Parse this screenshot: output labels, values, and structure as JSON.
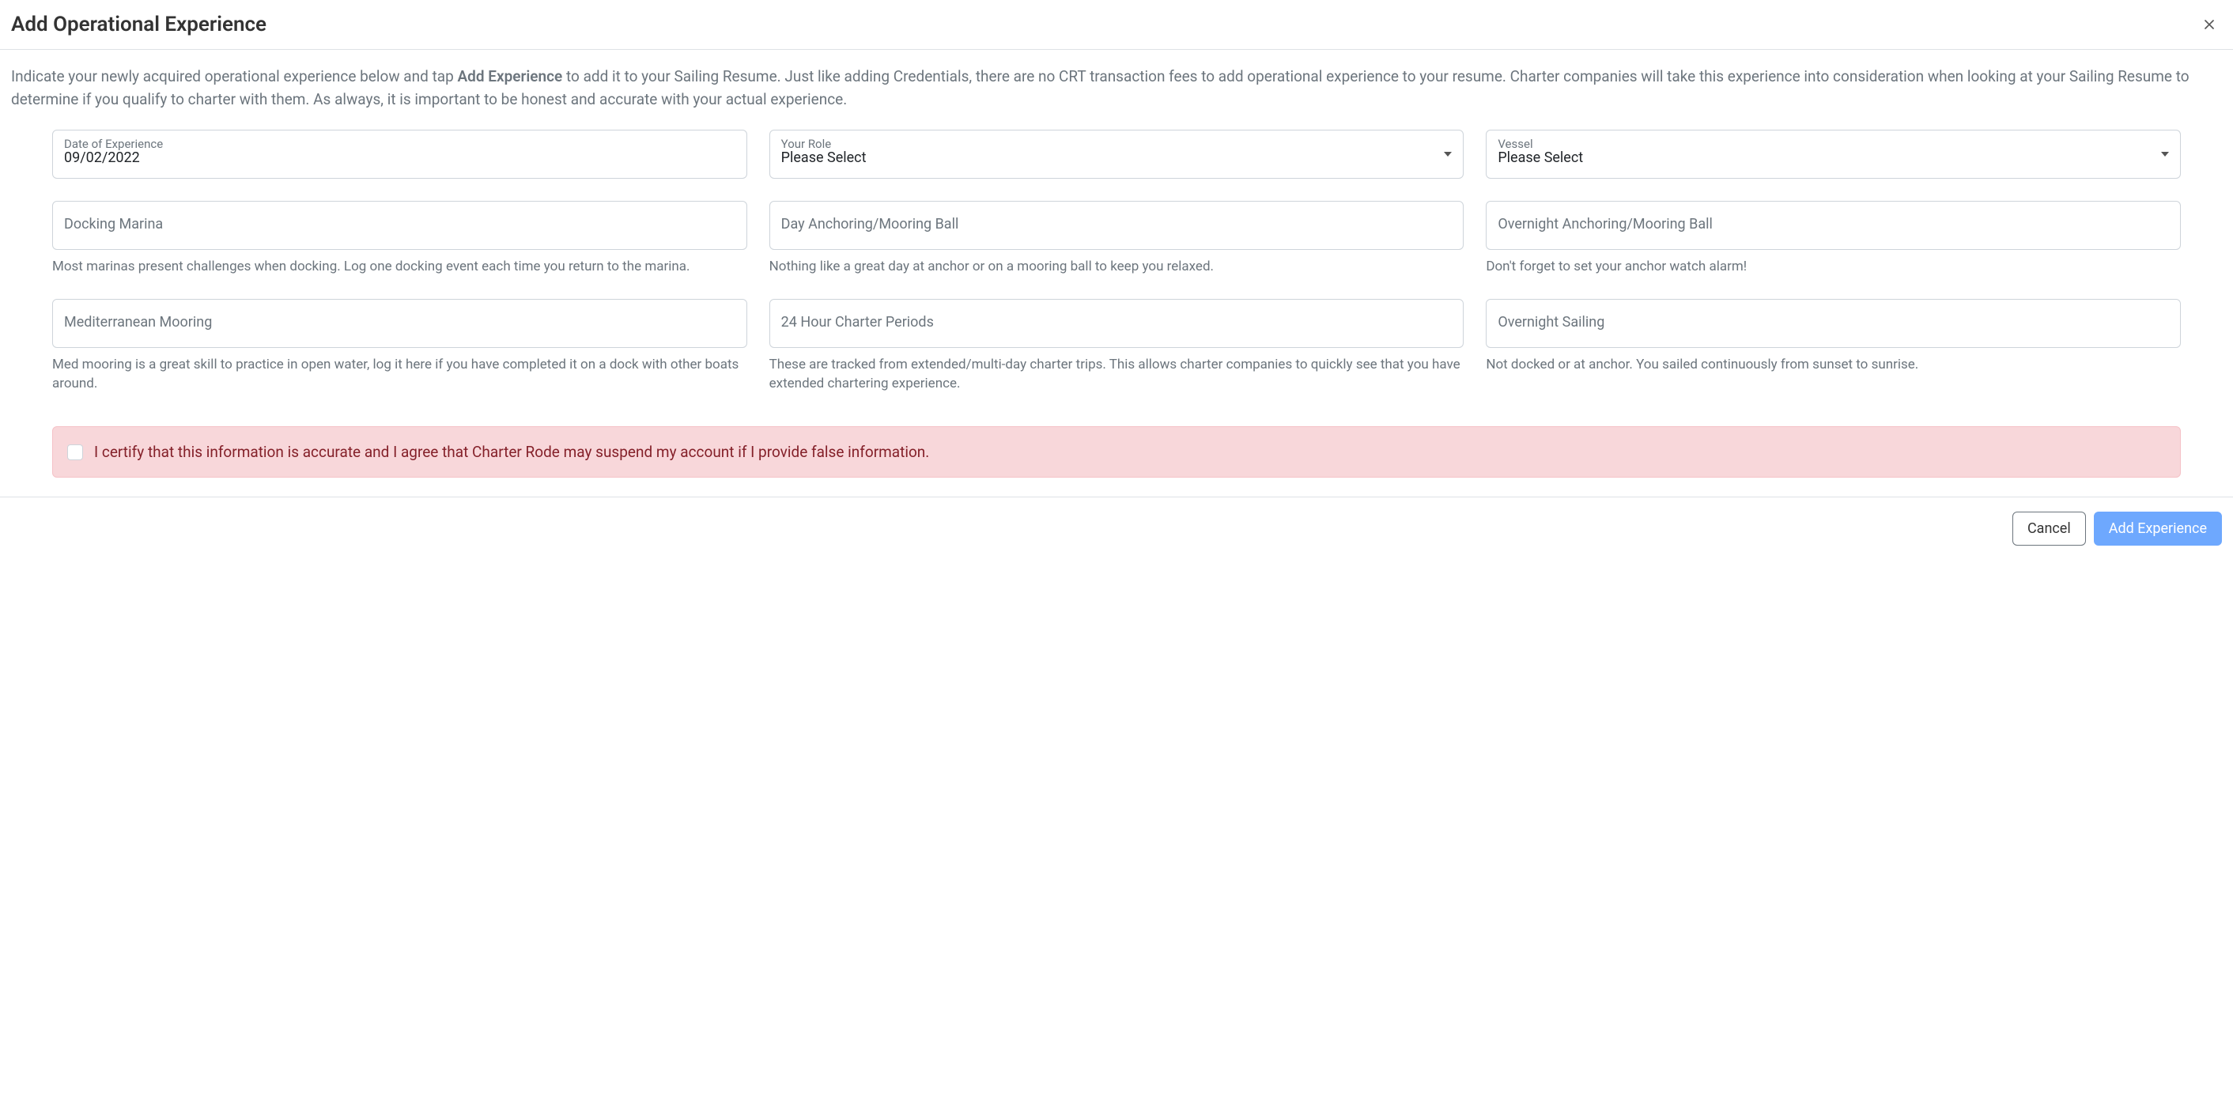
{
  "header": {
    "title": "Add Operational Experience"
  },
  "intro": {
    "part1": "Indicate your newly acquired operational experience below and tap ",
    "bold": "Add Experience",
    "part2": " to add it to your Sailing Resume. Just like adding Credentials, there are no CRT transaction fees to add operational experience to your resume. Charter companies will take this experience into consideration when looking at your Sailing Resume to determine if you qualify to charter with them. As always, it is important to be honest and accurate with your actual experience."
  },
  "fields": {
    "date": {
      "label": "Date of Experience",
      "value": "09/02/2022"
    },
    "role": {
      "label": "Your Role",
      "value": "Please Select"
    },
    "vessel": {
      "label": "Vessel",
      "value": "Please Select"
    },
    "docking": {
      "placeholder": "Docking Marina",
      "helper": "Most marinas present challenges when docking. Log one docking event each time you return to the marina."
    },
    "dayAnchor": {
      "placeholder": "Day Anchoring/Mooring Ball",
      "helper": "Nothing like a great day at anchor or on a mooring ball to keep you relaxed."
    },
    "overnightAnchor": {
      "placeholder": "Overnight Anchoring/Mooring Ball",
      "helper": "Don't forget to set your anchor watch alarm!"
    },
    "medMooring": {
      "placeholder": "Mediterranean Mooring",
      "helper": "Med mooring is a great skill to practice in open water, log it here if you have completed it on a dock with other boats around."
    },
    "charterPeriods": {
      "placeholder": "24 Hour Charter Periods",
      "helper": "These are tracked from extended/multi-day charter trips. This allows charter companies to quickly see that you have extended chartering experience."
    },
    "overnightSailing": {
      "placeholder": "Overnight Sailing",
      "helper": "Not docked or at anchor. You sailed continuously from sunset to sunrise."
    }
  },
  "certify": {
    "text": "I certify that this information is accurate and I agree that Charter Rode may suspend my account if I provide false information."
  },
  "footer": {
    "cancel": "Cancel",
    "submit": "Add Experience"
  }
}
